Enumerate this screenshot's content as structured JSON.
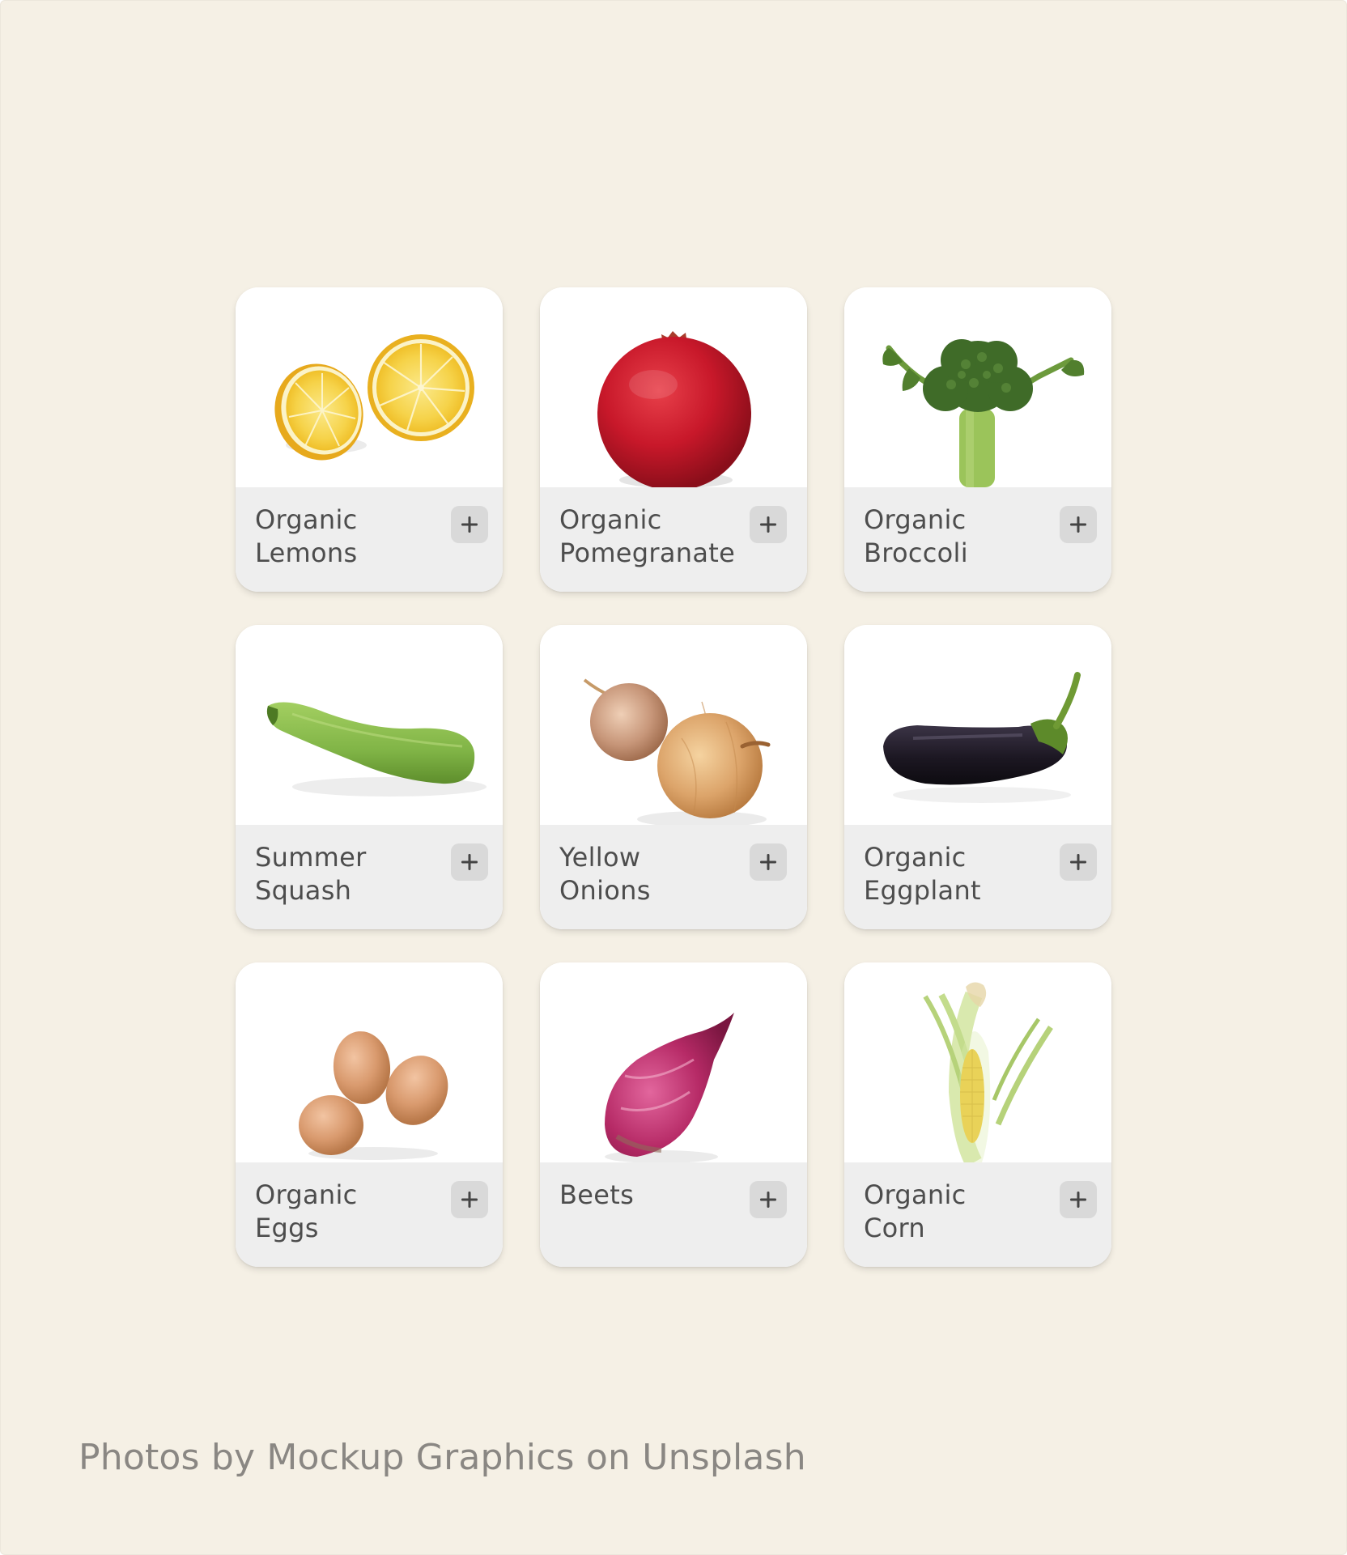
{
  "page": {
    "background_color": "#f5f0e5",
    "card_color": "#ffffff",
    "card_footer_color": "#eeeeee",
    "add_button_color": "#d9d9d9",
    "text_color": "#4d4d4d"
  },
  "products": [
    {
      "name_line1": "Organic",
      "name_line2": "Lemons",
      "image": "lemon-halves",
      "add_icon": "plus-icon"
    },
    {
      "name_line1": "Organic",
      "name_line2": "Pomegranate",
      "image": "pomegranate",
      "add_icon": "plus-icon"
    },
    {
      "name_line1": "Organic",
      "name_line2": "Broccoli",
      "image": "broccoli",
      "add_icon": "plus-icon"
    },
    {
      "name_line1": "Summer",
      "name_line2": "Squash",
      "image": "zucchini",
      "add_icon": "plus-icon"
    },
    {
      "name_line1": "Yellow",
      "name_line2": "Onions",
      "image": "onions",
      "add_icon": "plus-icon"
    },
    {
      "name_line1": "Organic",
      "name_line2": "Eggplant",
      "image": "eggplant",
      "add_icon": "plus-icon"
    },
    {
      "name_line1": "Organic",
      "name_line2": "Eggs",
      "image": "eggs",
      "add_icon": "plus-icon"
    },
    {
      "name_line1": "Beets",
      "name_line2": "",
      "image": "beet",
      "add_icon": "plus-icon"
    },
    {
      "name_line1": "Organic",
      "name_line2": "Corn",
      "image": "corn",
      "add_icon": "plus-icon"
    }
  ],
  "footer": {
    "credit": "Photos by Mockup Graphics on Unsplash"
  }
}
